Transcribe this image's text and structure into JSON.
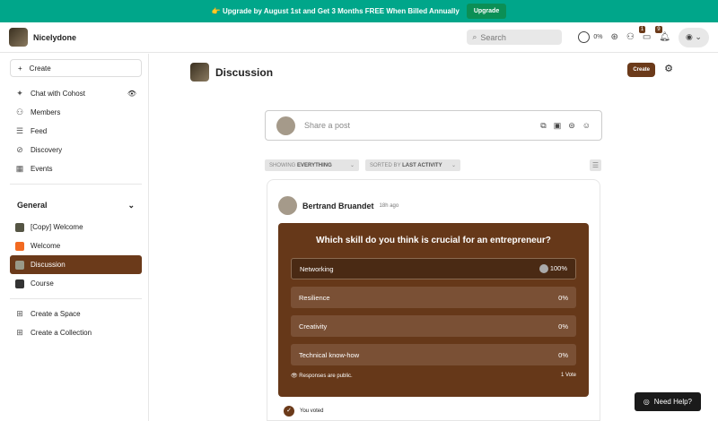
{
  "banner": {
    "text": "👉 Upgrade by August 1st and Get 3 Months FREE When Billed Annually",
    "button": "Upgrade"
  },
  "header": {
    "brand": "Nicelydone",
    "search_placeholder": "Search",
    "progress": "0%",
    "chat_badge": "1",
    "notif_badge": "9"
  },
  "sidebar": {
    "create": "Create",
    "items": [
      {
        "label": "Chat with Cohost",
        "icon": "sparkle"
      },
      {
        "label": "Members",
        "icon": "users"
      },
      {
        "label": "Feed",
        "icon": "feed"
      },
      {
        "label": "Discovery",
        "icon": "compass"
      },
      {
        "label": "Events",
        "icon": "calendar"
      }
    ],
    "group": "General",
    "spaces": [
      "[Copy] Welcome",
      "Welcome",
      "Discussion",
      "Course"
    ],
    "create_space": "Create a Space",
    "create_collection": "Create a Collection"
  },
  "main": {
    "title": "Discussion",
    "create": "Create",
    "share_placeholder": "Share a post",
    "filter_show_prefix": "SHOWING",
    "filter_show": "EVERYTHING",
    "filter_sort_prefix": "SORTED BY",
    "filter_sort": "LAST ACTIVITY",
    "post": {
      "author": "Bertrand Bruandet",
      "time": "18h ago",
      "question": "Which skill do you think is crucial for an entrepreneur?",
      "options": [
        {
          "label": "Networking",
          "pct": "100%"
        },
        {
          "label": "Resilience",
          "pct": "0%"
        },
        {
          "label": "Creativity",
          "pct": "0%"
        },
        {
          "label": "Technical know-how",
          "pct": "0%"
        }
      ],
      "public_note": "Responses are public.",
      "votes": "1 Vote",
      "voted": "You voted"
    }
  },
  "help": "Need Help?"
}
